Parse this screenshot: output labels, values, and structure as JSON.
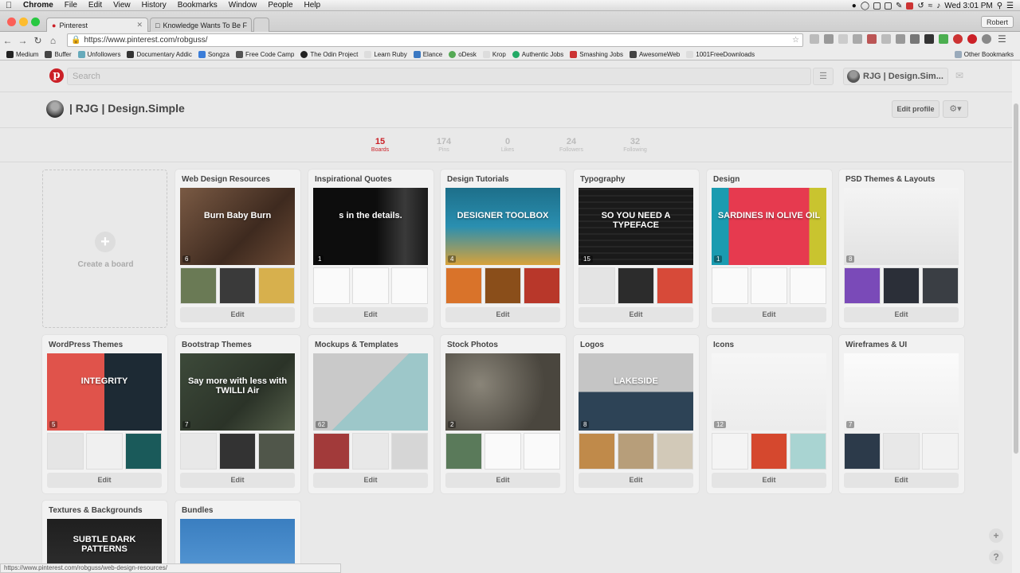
{
  "macos_menubar": {
    "app": "Chrome",
    "items": [
      "File",
      "Edit",
      "View",
      "History",
      "Bookmarks",
      "Window",
      "People",
      "Help"
    ],
    "clock": "Wed 3:01 PM"
  },
  "tabs": [
    {
      "title": "Pinterest"
    },
    {
      "title": "Knowledge Wants To Be F"
    }
  ],
  "profile_button": "Robert",
  "address_bar": {
    "url": "https://www.pinterest.com/robguss/"
  },
  "bookmarks": {
    "items": [
      "Medium",
      "Buffer",
      "Unfollowers",
      "Documentary Addic",
      "Songza",
      "Free Code Camp",
      "The Odin Project",
      "Learn Ruby",
      "Elance",
      "oDesk",
      "Krop",
      "Authentic Jobs",
      "Smashing Jobs",
      "AwesomeWeb",
      "1001FreeDownloads"
    ],
    "other": "Other Bookmarks"
  },
  "pinterest": {
    "search_placeholder": "Search",
    "user_button": "RJG | Design.Sim...",
    "profile_name": "| RJG | Design.Simple",
    "edit_profile": "Edit profile",
    "stats": [
      {
        "value": "15",
        "label": "Boards"
      },
      {
        "value": "174",
        "label": "Pins"
      },
      {
        "value": "0",
        "label": "Likes"
      },
      {
        "value": "24",
        "label": "Followers"
      },
      {
        "value": "32",
        "label": "Following"
      }
    ],
    "create_board": "Create a board",
    "edit_label": "Edit",
    "boards": [
      {
        "title": "Web Design Resources",
        "count": "6",
        "cover_text": "Burn Baby Burn"
      },
      {
        "title": "Inspirational Quotes",
        "count": "1",
        "cover_text": "s in the details."
      },
      {
        "title": "Design Tutorials",
        "count": "4",
        "cover_text": "DESIGNER TOOLBOX"
      },
      {
        "title": "Typography",
        "count": "15",
        "cover_text": "SO YOU NEED A TYPEFACE"
      },
      {
        "title": "Design",
        "count": "1",
        "cover_text": "SARDINES IN OLIVE OIL"
      },
      {
        "title": "PSD Themes & Layouts",
        "count": "8",
        "cover_text": ""
      },
      {
        "title": "WordPress Themes",
        "count": "5",
        "cover_text": "INTEGRITY"
      },
      {
        "title": "Bootstrap Themes",
        "count": "7",
        "cover_text": "Say more with less with TWILLI Air"
      },
      {
        "title": "Mockups & Templates",
        "count": "62",
        "cover_text": ""
      },
      {
        "title": "Stock Photos",
        "count": "2",
        "cover_text": ""
      },
      {
        "title": "Logos",
        "count": "8",
        "cover_text": "LAKESIDE"
      },
      {
        "title": "Icons",
        "count": "12",
        "cover_text": ""
      },
      {
        "title": "Wireframes & UI",
        "count": "7",
        "cover_text": ""
      },
      {
        "title": "Textures & Backgrounds",
        "count": "",
        "cover_text": "SUBTLE DARK PATTERNS"
      },
      {
        "title": "Bundles",
        "count": "",
        "cover_text": ""
      }
    ]
  },
  "status_url": "https://www.pinterest.com/robguss/web-design-resources/",
  "colors": {
    "pinterest_red": "#cb2027",
    "page_bg": "#e9e9e9"
  }
}
